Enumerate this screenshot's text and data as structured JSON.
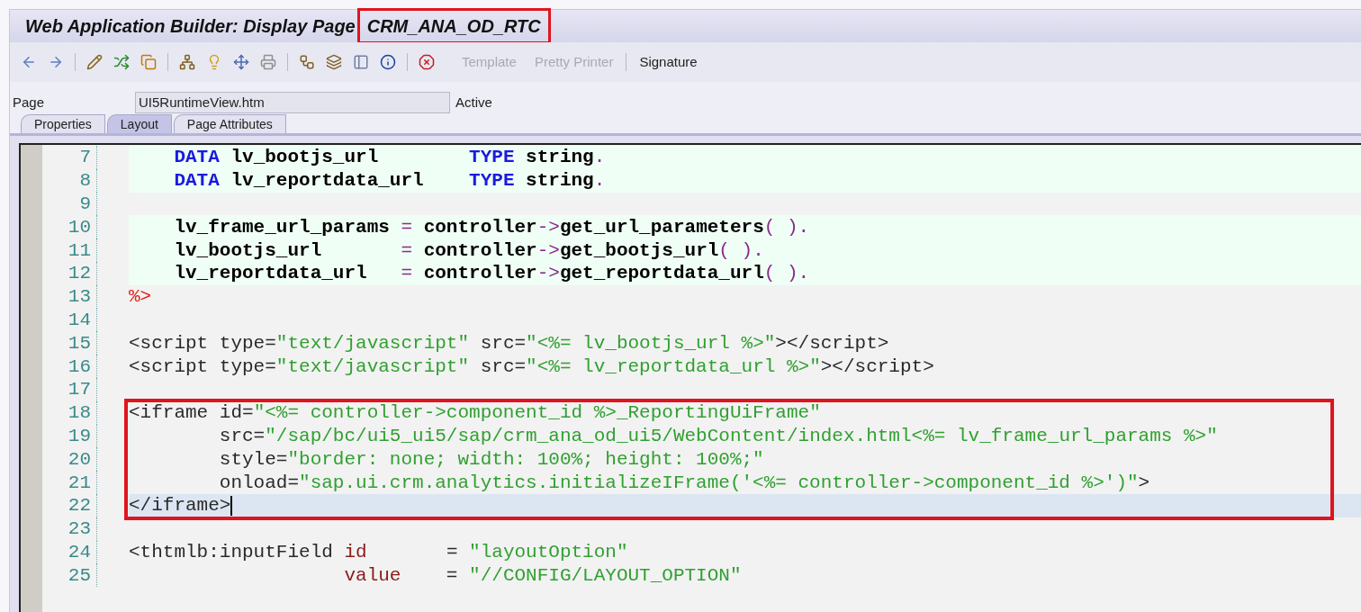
{
  "window": {
    "title": "Web Application Builder: Display Page",
    "object_name": "CRM_ANA_OD_RTC",
    "object_name_annotated": true
  },
  "toolbar": {
    "buttons": [
      {
        "label": "Template",
        "disabled": true
      },
      {
        "label": "Pretty Printer",
        "disabled": true
      },
      {
        "label": "Signature",
        "disabled": false
      }
    ]
  },
  "page_field": {
    "label": "Page",
    "value": "UI5RuntimeView.htm",
    "status": "Active"
  },
  "tabs": [
    {
      "label": "Properties",
      "selected": false
    },
    {
      "label": "Layout",
      "selected": true
    },
    {
      "label": "Page Attributes",
      "selected": false
    }
  ],
  "editor": {
    "lines": [
      {
        "number": "7",
        "kind": "abap",
        "current": false,
        "annotated": false,
        "tokens": [
          {
            "kind": "kw",
            "t": "    DATA"
          },
          {
            "kind": "id",
            "t": " lv_bootjs_url        "
          },
          {
            "kind": "kw",
            "t": "TYPE"
          },
          {
            "kind": "id",
            "t": " string"
          },
          {
            "kind": "op",
            "t": "."
          }
        ]
      },
      {
        "number": "8",
        "kind": "abap",
        "current": false,
        "annotated": false,
        "tokens": [
          {
            "kind": "kw",
            "t": "    DATA"
          },
          {
            "kind": "id",
            "t": " lv_reportdata_url    "
          },
          {
            "kind": "kw",
            "t": "TYPE"
          },
          {
            "kind": "id",
            "t": " string"
          },
          {
            "kind": "op",
            "t": "."
          }
        ]
      },
      {
        "number": "9",
        "kind": "html",
        "current": false,
        "annotated": false
      },
      {
        "number": "10",
        "kind": "abap",
        "current": false,
        "annotated": false,
        "tokens": [
          {
            "kind": "id",
            "t": "    lv_frame_url_params "
          },
          {
            "kind": "op",
            "t": "="
          },
          {
            "kind": "id",
            "t": " controller"
          },
          {
            "kind": "op",
            "t": "->"
          },
          {
            "kind": "id",
            "t": "get_url_parameters"
          },
          {
            "kind": "op",
            "t": "( )."
          }
        ]
      },
      {
        "number": "11",
        "kind": "abap",
        "current": false,
        "annotated": false,
        "tokens": [
          {
            "kind": "id",
            "t": "    lv_bootjs_url       "
          },
          {
            "kind": "op",
            "t": "="
          },
          {
            "kind": "id",
            "t": " controller"
          },
          {
            "kind": "op",
            "t": "->"
          },
          {
            "kind": "id",
            "t": "get_bootjs_url"
          },
          {
            "kind": "op",
            "t": "( )."
          }
        ]
      },
      {
        "number": "12",
        "kind": "abap",
        "current": false,
        "annotated": false,
        "tokens": [
          {
            "kind": "id",
            "t": "    lv_reportdata_url   "
          },
          {
            "kind": "op",
            "t": "="
          },
          {
            "kind": "id",
            "t": " controller"
          },
          {
            "kind": "op",
            "t": "->"
          },
          {
            "kind": "id",
            "t": "get_reportdata_url"
          },
          {
            "kind": "op",
            "t": "( )."
          }
        ]
      },
      {
        "number": "13",
        "kind": "html",
        "current": false,
        "annotated": false,
        "tokens": [
          {
            "kind": "delim",
            "t": "%>"
          }
        ]
      },
      {
        "number": "14",
        "kind": "html",
        "current": false,
        "annotated": false
      },
      {
        "number": "15",
        "kind": "html",
        "current": false,
        "annotated": false,
        "tokens": [
          {
            "kind": "tag",
            "t": "<script type="
          },
          {
            "kind": "str",
            "t": "\"text/javascript\""
          },
          {
            "kind": "tag",
            "t": " src="
          },
          {
            "kind": "str",
            "t": "\"<%= lv_bootjs_url %>\""
          },
          {
            "kind": "tag",
            "t": "></script>"
          }
        ]
      },
      {
        "number": "16",
        "kind": "html",
        "current": false,
        "annotated": false,
        "tokens": [
          {
            "kind": "tag",
            "t": "<script type="
          },
          {
            "kind": "str",
            "t": "\"text/javascript\""
          },
          {
            "kind": "tag",
            "t": " src="
          },
          {
            "kind": "str",
            "t": "\"<%= lv_reportdata_url %>\""
          },
          {
            "kind": "tag",
            "t": "></script>"
          }
        ]
      },
      {
        "number": "17",
        "kind": "html",
        "current": false,
        "annotated": false
      },
      {
        "number": "18",
        "kind": "html",
        "current": false,
        "annotated": true,
        "tokens": [
          {
            "kind": "tag",
            "t": "<iframe id="
          },
          {
            "kind": "str",
            "t": "\"<%= controller->component_id %>_ReportingUiFrame\""
          }
        ]
      },
      {
        "number": "19",
        "kind": "html",
        "current": false,
        "annotated": true,
        "tokens": [
          {
            "kind": "tag",
            "t": "        src="
          },
          {
            "kind": "str",
            "t": "\"/sap/bc/ui5_ui5/sap/crm_ana_od_ui5/WebContent/index.html<%= lv_frame_url_params %>\""
          }
        ]
      },
      {
        "number": "20",
        "kind": "html",
        "current": false,
        "annotated": true,
        "tokens": [
          {
            "kind": "tag",
            "t": "        style="
          },
          {
            "kind": "str",
            "t": "\"border: none; width: 100%; height: 100%;\""
          }
        ]
      },
      {
        "number": "21",
        "kind": "html",
        "current": false,
        "annotated": true,
        "tokens": [
          {
            "kind": "tag",
            "t": "        onload="
          },
          {
            "kind": "str",
            "t": "\"sap.ui.crm.analytics.initializeIFrame('<%= controller->component_id %>')\""
          },
          {
            "kind": "tag",
            "t": ">"
          }
        ]
      },
      {
        "number": "22",
        "kind": "html",
        "current": true,
        "annotated": true,
        "tokens": [
          {
            "kind": "tag",
            "t": "</iframe>"
          }
        ]
      },
      {
        "number": "23",
        "kind": "html",
        "current": false,
        "annotated": false
      },
      {
        "number": "24",
        "kind": "html",
        "current": false,
        "annotated": false,
        "tokens": [
          {
            "kind": "tag",
            "t": "<thtmlb:inputField "
          },
          {
            "kind": "attr",
            "t": "id"
          },
          {
            "kind": "tag",
            "t": "       = "
          },
          {
            "kind": "str",
            "t": "\"layoutOption\""
          }
        ]
      },
      {
        "number": "25",
        "kind": "html",
        "current": false,
        "annotated": false,
        "tokens": [
          {
            "kind": "attr",
            "t": "                   value"
          },
          {
            "kind": "tag",
            "t": "    = "
          },
          {
            "kind": "str",
            "t": "\"//CONFIG/LAYOUT_OPTION\""
          }
        ]
      }
    ]
  }
}
